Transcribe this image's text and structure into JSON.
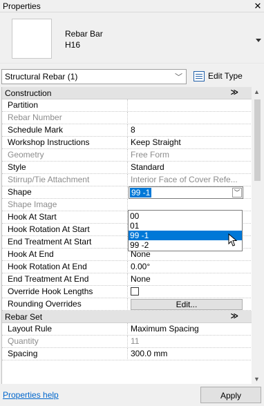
{
  "window": {
    "title": "Properties",
    "close": "✕"
  },
  "type_selector": {
    "family": "Rebar Bar",
    "name": "H16"
  },
  "filter": {
    "value": "Structural Rebar (1)",
    "edit_type_label": "Edit Type"
  },
  "groups": {
    "construction": "Construction",
    "rebar_set": "Rebar Set"
  },
  "rows": [
    {
      "name": "Partition",
      "value": ""
    },
    {
      "name": "Rebar Number",
      "value": ""
    },
    {
      "name": "Schedule Mark",
      "value": "8"
    },
    {
      "name": "Workshop Instructions",
      "value": "Keep Straight"
    },
    {
      "name": "Geometry",
      "value": "Free Form"
    },
    {
      "name": "Style",
      "value": "Standard"
    },
    {
      "name": "Stirrup/Tie Attachment",
      "value": "Interior Face of Cover Refe..."
    },
    {
      "name": "Shape",
      "value": "99 -1"
    },
    {
      "name": "Shape Image",
      "value": ""
    },
    {
      "name": "Hook At Start",
      "value": ""
    },
    {
      "name": "Hook Rotation At Start",
      "value": ""
    },
    {
      "name": "End Treatment At Start",
      "value": ""
    },
    {
      "name": "Hook At End",
      "value": "None"
    },
    {
      "name": "Hook Rotation At End",
      "value": "0.00°"
    },
    {
      "name": "End Treatment At End",
      "value": "None"
    },
    {
      "name": "Override Hook Lengths",
      "value": ""
    },
    {
      "name": "Rounding Overrides",
      "value": "Edit..."
    }
  ],
  "rebar_set_rows": [
    {
      "name": "Layout Rule",
      "value": "Maximum Spacing"
    },
    {
      "name": "Quantity",
      "value": "11"
    },
    {
      "name": "Spacing",
      "value": "300.0 mm"
    }
  ],
  "shape_options": [
    "00",
    "01",
    "99 -1",
    "99 -2"
  ],
  "footer": {
    "help": "Properties help",
    "apply": "Apply"
  }
}
